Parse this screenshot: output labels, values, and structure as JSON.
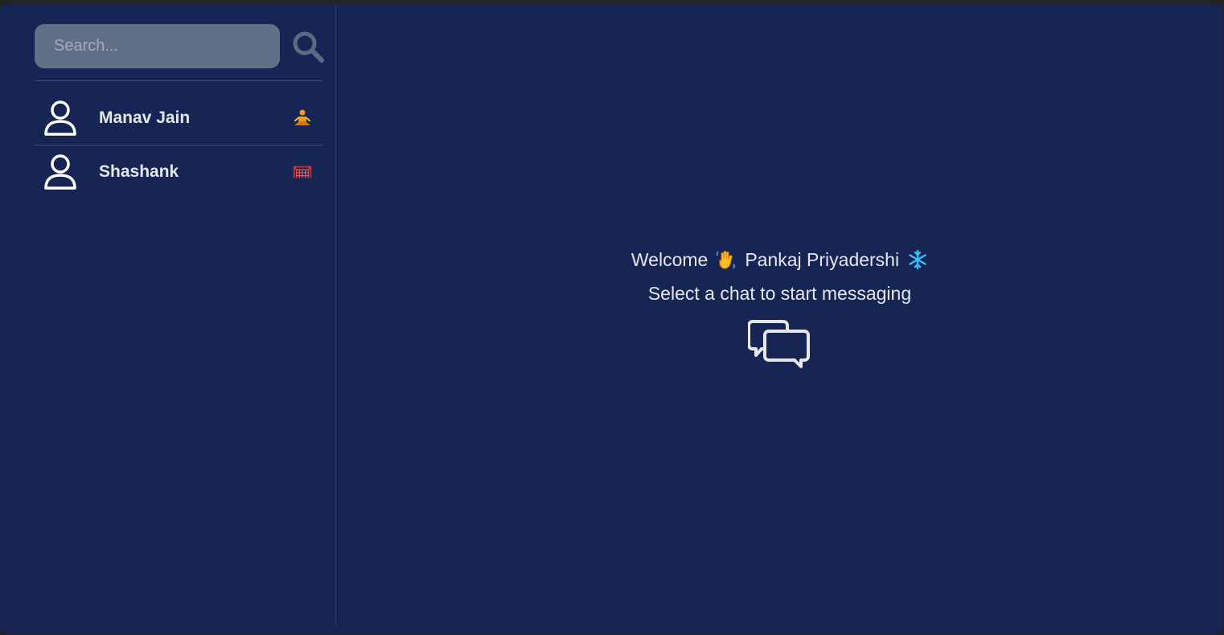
{
  "search": {
    "placeholder": "Search..."
  },
  "conversations": [
    {
      "name": "Manav Jain",
      "emoji_icon": "person-in-lotus-position-emoji"
    },
    {
      "name": "Shashank",
      "emoji_icon": "goal-net-emoji"
    }
  ],
  "welcome": {
    "greeting": "Welcome",
    "wave_icon": "waving-hand-emoji",
    "user_name": "Pankaj Priyadershi",
    "snow_icon": "snowflake-emoji",
    "subtitle": "Select a chat to start messaging"
  },
  "colors": {
    "background": "#172554",
    "search_bg": "#627087",
    "text": "#e5e7eb",
    "accent_icon": "#64748b"
  }
}
